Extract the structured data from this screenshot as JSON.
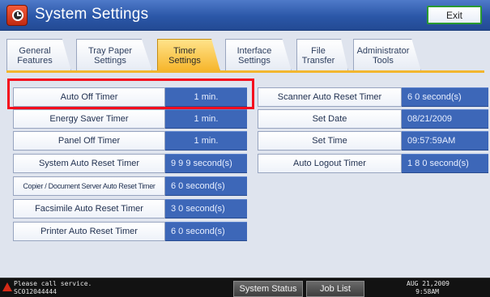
{
  "window": {
    "title": "System Settings",
    "exit_label": "Exit"
  },
  "tabs": [
    {
      "label": "General\nFeatures",
      "active": false
    },
    {
      "label": "Tray Paper\nSettings",
      "active": false
    },
    {
      "label": "Timer\nSettings",
      "active": true
    },
    {
      "label": "Interface\nSettings",
      "active": false
    },
    {
      "label": "File\nTransfer",
      "active": false
    },
    {
      "label": "Administrator\nTools",
      "active": false
    }
  ],
  "left_settings": [
    {
      "label": "Auto Off Timer",
      "value": "1 min."
    },
    {
      "label": "Energy Saver Timer",
      "value": "1 min."
    },
    {
      "label": "Panel Off Timer",
      "value": "1 min."
    },
    {
      "label": "System Auto Reset Timer",
      "value": "9 9 9 second(s)"
    },
    {
      "label": "Copier / Document Server Auto Reset Timer",
      "value": "6 0 second(s)"
    },
    {
      "label": "Facsimile Auto Reset Timer",
      "value": "3 0 second(s)"
    },
    {
      "label": "Printer Auto Reset Timer",
      "value": "6 0 second(s)"
    }
  ],
  "right_settings": [
    {
      "label": "Scanner Auto Reset Timer",
      "value": "6 0 second(s)"
    },
    {
      "label": "Set Date",
      "value": "08/21/2009"
    },
    {
      "label": "Set Time",
      "value": "09:57:59AM"
    },
    {
      "label": "Auto Logout Timer",
      "value": "1 8 0 second(s)"
    }
  ],
  "status_bar": {
    "message": "Please call service.",
    "code": "SC012044444",
    "buttons": [
      "System Status",
      "Job List"
    ],
    "date": "AUG  21,2009",
    "time": "9:58AM"
  },
  "colors": {
    "title_blue": "#2b57a8",
    "value_blue": "#3d67b8",
    "active_tab": "#f6b52a",
    "highlight_red": "#f40d1d",
    "exit_border": "#2a9b31"
  }
}
